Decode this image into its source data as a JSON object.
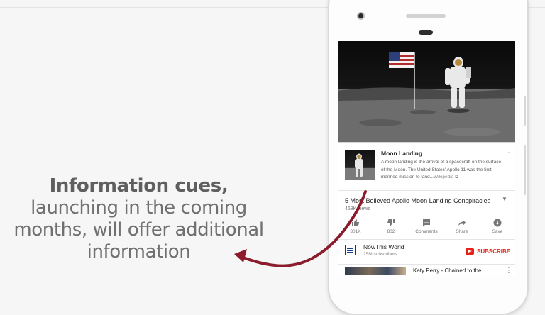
{
  "caption": {
    "bold": "Information cues,",
    "rest": " launching in the coming months, will offer additional information"
  },
  "info_card": {
    "title": "Moon Landing",
    "description": "A moon landing is the arrival of a spacecraft on the surface of the Moon. The United States' Apollo 11 was the first manned mission to land...",
    "source": "Wikipedia"
  },
  "video": {
    "title": "5 Most Believed Apollo Moon Landing Conspiracies",
    "views": "468K views",
    "progress": 0.0
  },
  "actions": [
    {
      "icon": "thumbs-up-icon",
      "label": "301K"
    },
    {
      "icon": "thumbs-down-icon",
      "label": "802"
    },
    {
      "icon": "comments-icon",
      "label": "Comments"
    },
    {
      "icon": "share-icon",
      "label": "Share"
    },
    {
      "icon": "save-icon",
      "label": "Save"
    }
  ],
  "channel": {
    "name": "NowThis World",
    "subscribers": "25M subscribers",
    "subscribe_label": "SUBSCRIBE"
  },
  "next_video": {
    "title": "Katy Perry - Chained to the"
  },
  "colors": {
    "accent": "#e62117",
    "arrow": "#8c1b2b"
  }
}
